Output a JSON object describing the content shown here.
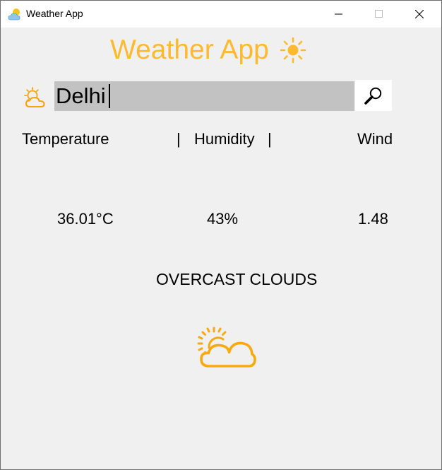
{
  "window": {
    "title": "Weather App",
    "icon": "weather-cloud-sun-icon",
    "controls": [
      "minimize-icon",
      "maximize-icon",
      "close-icon"
    ]
  },
  "header": {
    "title": "Weather App",
    "icon": "sun-icon",
    "color": "#fdb930"
  },
  "search": {
    "value": "Delhi",
    "left_icon": "cloud-sun-icon",
    "button_icon": "magnifier-icon",
    "selection_color": "#c2c2c2"
  },
  "labels": {
    "temperature": "Temperature",
    "separator1": "|",
    "humidity": "Humidity",
    "separator2": "|",
    "wind": "Wind"
  },
  "values": {
    "temperature": "36.01°C",
    "humidity": "43%",
    "wind": "1.48"
  },
  "condition": {
    "description": "OVERCAST CLOUDS",
    "icon": "cloud-sun-icon"
  }
}
